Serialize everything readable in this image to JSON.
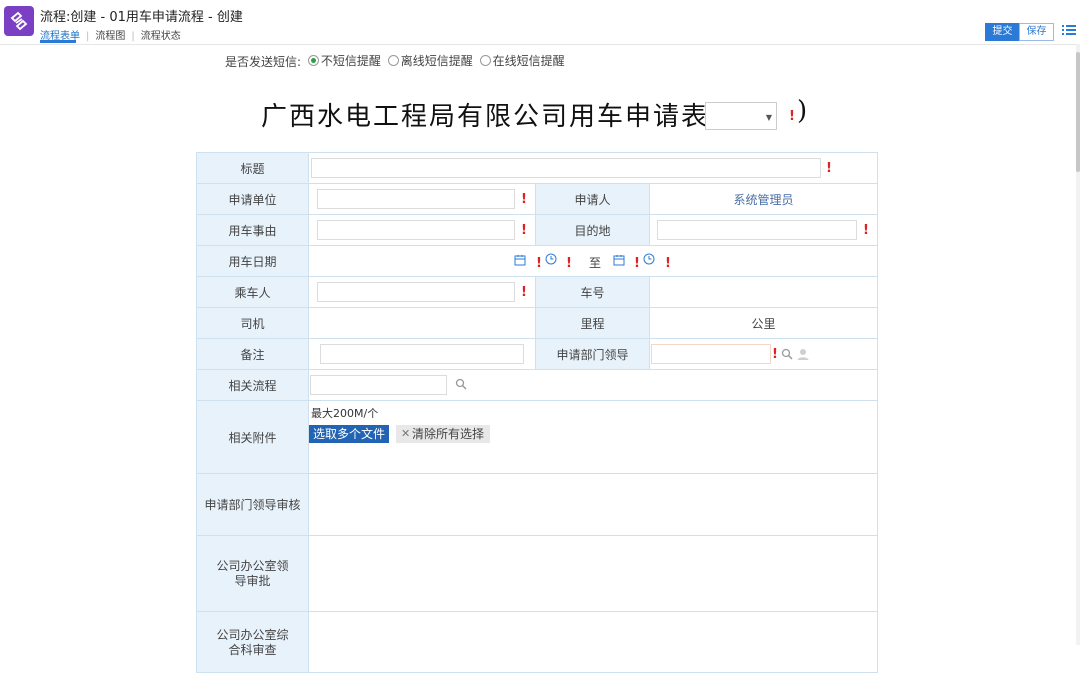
{
  "window": {
    "title": "流程:创建 - 01用车申请流程 - 创建",
    "tabs": [
      "流程表单",
      "流程图",
      "流程状态"
    ],
    "actions": {
      "submit": "提交",
      "save": "保存"
    }
  },
  "sms": {
    "label": "是否发送短信:",
    "options": [
      "不短信提醒",
      "离线短信提醒",
      "在线短信提醒"
    ],
    "selected": "不短信提醒"
  },
  "form": {
    "title_text": "广西水电工程局有限公司用车申请表(",
    "title_close": ")",
    "title_select_value": "",
    "required_mark": "!",
    "fields": {
      "title": {
        "label": "标题",
        "value": ""
      },
      "apply_unit": {
        "label": "申请单位",
        "value": ""
      },
      "applicant": {
        "label": "申请人",
        "value": "系统管理员"
      },
      "reason": {
        "label": "用车事由",
        "value": ""
      },
      "destination": {
        "label": "目的地",
        "value": ""
      },
      "date": {
        "label": "用车日期",
        "to": "至"
      },
      "passengers": {
        "label": "乘车人",
        "value": ""
      },
      "car_no": {
        "label": "车号",
        "value": ""
      },
      "driver": {
        "label": "司机",
        "value": ""
      },
      "mileage": {
        "label": "里程",
        "unit": "公里"
      },
      "remarks": {
        "label": "备注",
        "value": ""
      },
      "dept_leader": {
        "label": "申请部门领导",
        "value": ""
      },
      "related_flow": {
        "label": "相关流程",
        "value": ""
      },
      "attachment": {
        "label": "相关附件",
        "limit": "最大200M/个",
        "pick_button": "选取多个文件",
        "clear_button": "清除所有选择"
      },
      "dept_review": {
        "label": "申请部门领导审核"
      },
      "office_approve": {
        "label": "公司办公室领导审批"
      },
      "office_audit": {
        "label": "公司办公室综合科审查"
      }
    }
  },
  "colors": {
    "accent": "#2b7ad6",
    "label_bg": "#e8f2fb",
    "required": "#dd2222",
    "app_icon": "#7b3fc4"
  }
}
